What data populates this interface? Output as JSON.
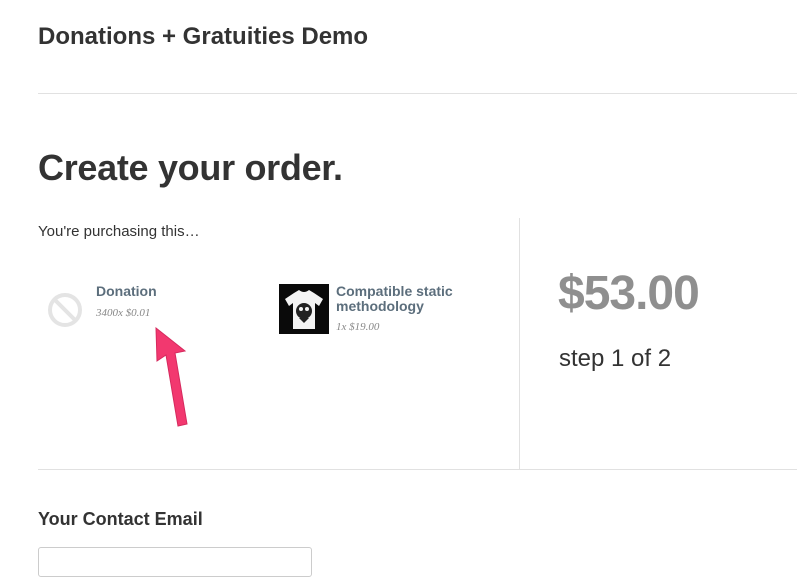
{
  "header": {
    "site_title": "Donations + Gratuities Demo"
  },
  "main": {
    "heading": "Create your order.",
    "purchasing_label": "You're purchasing this…",
    "items": [
      {
        "name": "Donation",
        "quantity_price": "3400x $0.01",
        "icon": "no-image-icon"
      },
      {
        "name": "Compatible static methodology",
        "quantity_price": "1x $19.00",
        "icon": "tshirt-thumbnail"
      }
    ],
    "total": "$53.00",
    "step": "step 1 of 2"
  },
  "contact": {
    "heading": "Your Contact Email",
    "email_value": "",
    "email_placeholder": ""
  },
  "annotation": {
    "arrow_color": "#f2386f"
  },
  "colors": {
    "text": "#333333",
    "item_name": "#5c6e7c",
    "muted": "#888888",
    "total": "#8f8f8f",
    "divider": "#e1e1e1"
  }
}
